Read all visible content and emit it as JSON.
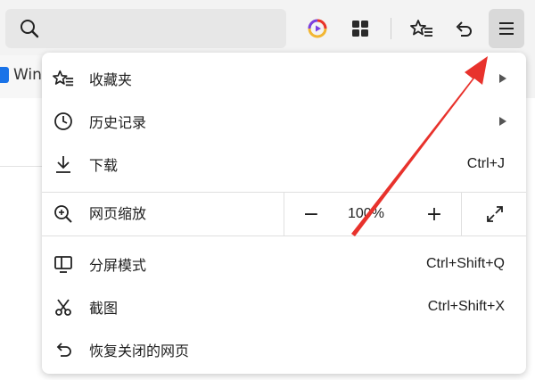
{
  "toolbar": {
    "icons": [
      "search-icon",
      "video-icon",
      "apps-grid-icon",
      "favorites-icon",
      "undo-icon",
      "menu-icon"
    ]
  },
  "bookmark_bar": {
    "item_label": "Win"
  },
  "menu": {
    "items": [
      {
        "icon": "favorites-icon",
        "label": "收藏夹",
        "submenu": true
      },
      {
        "icon": "history-icon",
        "label": "历史记录",
        "submenu": true
      },
      {
        "icon": "download-icon",
        "label": "下载",
        "shortcut": "Ctrl+J"
      },
      {
        "icon": "split-screen-icon",
        "label": "分屏模式",
        "shortcut": "Ctrl+Shift+Q"
      },
      {
        "icon": "screenshot-icon",
        "label": "截图",
        "shortcut": "Ctrl+Shift+X"
      },
      {
        "icon": "restore-icon",
        "label": "恢复关闭的网页"
      }
    ],
    "zoom": {
      "label": "网页缩放",
      "value": "100%",
      "minus": "−",
      "plus": "+"
    }
  },
  "annotation": {
    "color": "#e8322c",
    "type": "red-arrow",
    "points_to": "menu-button"
  }
}
